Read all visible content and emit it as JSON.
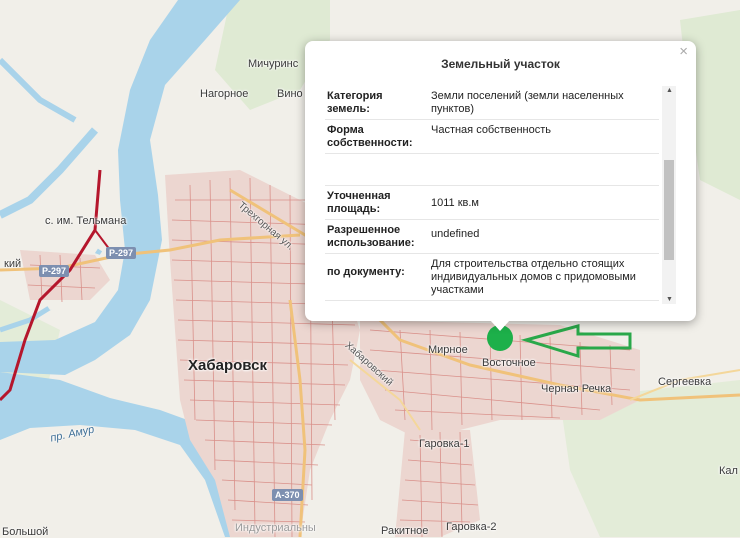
{
  "popup": {
    "title": "Земельный участок",
    "close": "×",
    "rows": [
      {
        "key": "Категория земель:",
        "value": "Земли поселений (земли населенных пунктов)"
      },
      {
        "key": "Форма собственности:",
        "value": "Частная собственность"
      },
      {
        "key": "",
        "value": ""
      },
      {
        "key": "Уточненная площадь:",
        "value": "1011 кв.м"
      },
      {
        "key": "Разрешенное использование:",
        "value": "undefined"
      },
      {
        "key": "по документу:",
        "value": "Для строительства отдельно стоящих индивидуальных домов с придомовыми участками"
      }
    ]
  },
  "map": {
    "city": "Хабаровск",
    "places": [
      "Мичуринс",
      "Нагорное",
      "Вино",
      "с. им. Тельмана",
      "кий",
      "Мирное",
      "Восточное",
      "Черная Речка",
      "Сергеевка",
      "Гаровка-1",
      "Гаровка-2",
      "Ракитное",
      "Кал",
      "Индустриальны",
      "Большой"
    ],
    "roads": [
      "Трехгорная ул.",
      "пр. Амур",
      "Хабаровский"
    ],
    "road_shields": [
      "Р-297",
      "Р-297",
      "А-370"
    ],
    "colors": {
      "water": "#a9d3ea",
      "marker": "#1db04a",
      "arrow": "#2aa84a",
      "federal_road": "#b5162c"
    }
  }
}
